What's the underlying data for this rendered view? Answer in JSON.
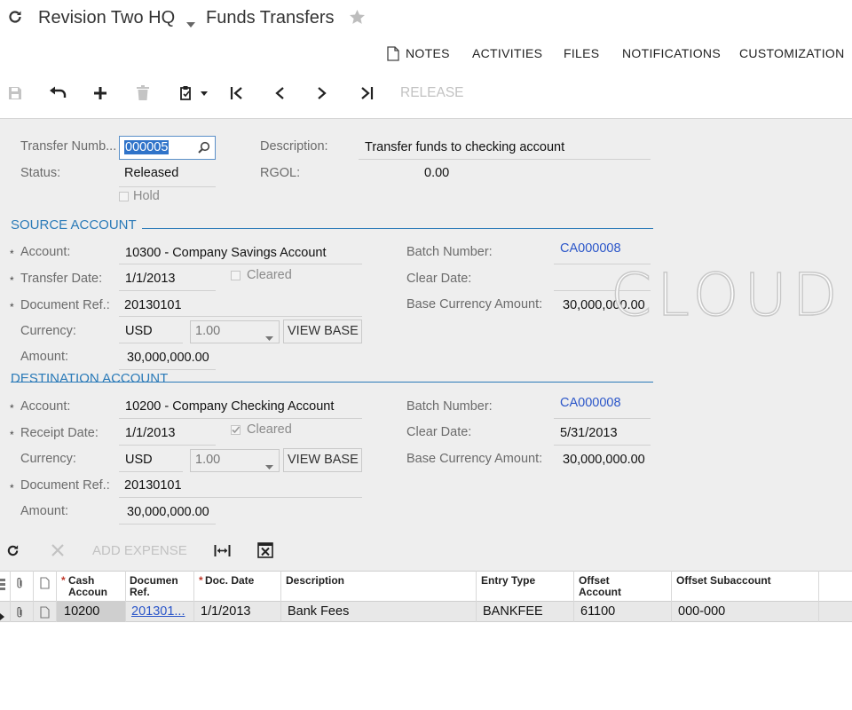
{
  "header": {
    "company": "Revision Two HQ",
    "screen_title": "Funds Transfers",
    "icons": {
      "refresh": "refresh-icon",
      "dropdown": "chevron-down-icon",
      "favorite": "star-icon"
    }
  },
  "util_menu": {
    "notes": "NOTES",
    "activities": "ACTIVITIES",
    "files": "FILES",
    "notifications": "NOTIFICATIONS",
    "customization": "CUSTOMIZATION"
  },
  "toolbar": {
    "release": "RELEASE",
    "icons": [
      "save-icon",
      "undo-icon",
      "add-icon",
      "delete-icon",
      "clipboard-icon",
      "first-icon",
      "prev-icon",
      "next-icon",
      "last-icon"
    ]
  },
  "summary": {
    "transfer_number_label": "Transfer Numb...",
    "transfer_number_value": "000005",
    "status_label": "Status:",
    "status_value": "Released",
    "hold_label": "Hold",
    "description_label": "Description:",
    "description_value": "Transfer funds to checking account",
    "rgol_label": "RGOL:",
    "rgol_value": "0.00"
  },
  "source": {
    "section_title": "SOURCE ACCOUNT",
    "account_label": "Account:",
    "account_value": "10300 - Company Savings Account",
    "transfer_date_label": "Transfer Date:",
    "transfer_date_value": "1/1/2013",
    "cleared_label": "Cleared",
    "document_ref_label": "Document Ref.:",
    "document_ref_value": "20130101",
    "currency_label": "Currency:",
    "currency_value": "USD",
    "rate_value": "1.00",
    "view_base_label": "VIEW BASE",
    "amount_label": "Amount:",
    "amount_value": "30,000,000.00",
    "batch_number_label": "Batch Number:",
    "batch_number_value": "CA000008",
    "clear_date_label": "Clear Date:",
    "clear_date_value": "",
    "base_currency_amount_label": "Base Currency Amount:",
    "base_currency_amount_value": "30,000,000.00"
  },
  "destination": {
    "section_title": "DESTINATION ACCOUNT",
    "account_label": "Account:",
    "account_value": "10200 - Company Checking Account",
    "receipt_date_label": "Receipt Date:",
    "receipt_date_value": "1/1/2013",
    "cleared_label": "Cleared",
    "currency_label": "Currency:",
    "currency_value": "USD",
    "rate_value": "1.00",
    "view_base_label": "VIEW BASE",
    "document_ref_label": "Document Ref.:",
    "document_ref_value": "20130101",
    "amount_label": "Amount:",
    "amount_value": "30,000,000.00",
    "batch_number_label": "Batch Number:",
    "batch_number_value": "CA000008",
    "clear_date_label": "Clear Date:",
    "clear_date_value": "5/31/2013",
    "base_currency_amount_label": "Base Currency Amount:",
    "base_currency_amount_value": "30,000,000.00"
  },
  "watermark": "CLOUD",
  "grid_toolbar": {
    "add_expense": "ADD EXPENSE"
  },
  "grid": {
    "headers": {
      "cash_account": "Cash Accoun",
      "document_ref": "Documen Ref.",
      "doc_date": "Doc. Date",
      "description": "Description",
      "entry_type": "Entry Type",
      "offset_account": "Offset Account",
      "offset_subaccount": "Offset Subaccount"
    },
    "rows": [
      {
        "cash_account": "10200",
        "document_ref": "201301...",
        "doc_date": "1/1/2013",
        "description": "Bank Fees",
        "entry_type": "BANKFEE",
        "offset_account": "61100",
        "offset_subaccount": "000-000"
      }
    ]
  },
  "colors": {
    "accent": "#2a7ab8",
    "link": "#2b56c9",
    "form_bg": "#eeeeee"
  }
}
